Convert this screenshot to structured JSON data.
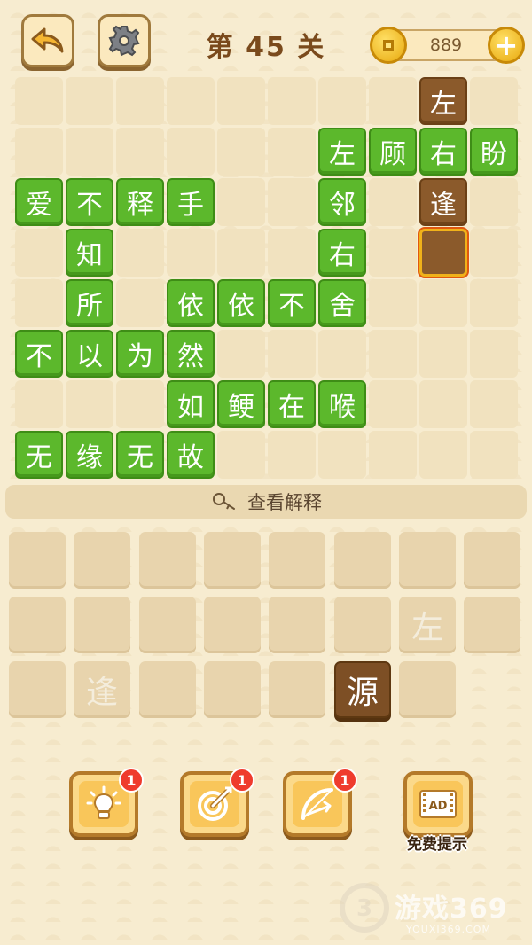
{
  "header": {
    "back_icon": "back-arrow-icon",
    "settings_icon": "gear-icon",
    "level_title": "第 45 关",
    "coins": "889",
    "plus_label": "+"
  },
  "colors": {
    "green_tile": "#5cb82c",
    "brown_tile": "#8b5a2b",
    "empty_cell": "#f1e2bf",
    "selected_border": "#f0b21a"
  },
  "board": {
    "rows": 8,
    "cols": 10,
    "tiles": [
      {
        "row": 0,
        "col": 8,
        "char": "左",
        "style": "brown"
      },
      {
        "row": 1,
        "col": 6,
        "char": "左",
        "style": "green"
      },
      {
        "row": 1,
        "col": 7,
        "char": "顾",
        "style": "green"
      },
      {
        "row": 1,
        "col": 8,
        "char": "右",
        "style": "green"
      },
      {
        "row": 1,
        "col": 9,
        "char": "盼",
        "style": "green"
      },
      {
        "row": 2,
        "col": 0,
        "char": "爱",
        "style": "green"
      },
      {
        "row": 2,
        "col": 1,
        "char": "不",
        "style": "green"
      },
      {
        "row": 2,
        "col": 2,
        "char": "释",
        "style": "green"
      },
      {
        "row": 2,
        "col": 3,
        "char": "手",
        "style": "green"
      },
      {
        "row": 2,
        "col": 6,
        "char": "邻",
        "style": "green"
      },
      {
        "row": 2,
        "col": 8,
        "char": "逢",
        "style": "brown"
      },
      {
        "row": 3,
        "col": 1,
        "char": "知",
        "style": "green"
      },
      {
        "row": 3,
        "col": 6,
        "char": "右",
        "style": "green"
      },
      {
        "row": 3,
        "col": 8,
        "char": "",
        "style": "selected"
      },
      {
        "row": 4,
        "col": 1,
        "char": "所",
        "style": "green"
      },
      {
        "row": 4,
        "col": 3,
        "char": "依",
        "style": "green"
      },
      {
        "row": 4,
        "col": 4,
        "char": "依",
        "style": "green"
      },
      {
        "row": 4,
        "col": 5,
        "char": "不",
        "style": "green"
      },
      {
        "row": 4,
        "col": 6,
        "char": "舍",
        "style": "green"
      },
      {
        "row": 5,
        "col": 0,
        "char": "不",
        "style": "green"
      },
      {
        "row": 5,
        "col": 1,
        "char": "以",
        "style": "green"
      },
      {
        "row": 5,
        "col": 2,
        "char": "为",
        "style": "green"
      },
      {
        "row": 5,
        "col": 3,
        "char": "然",
        "style": "green"
      },
      {
        "row": 6,
        "col": 3,
        "char": "如",
        "style": "green"
      },
      {
        "row": 6,
        "col": 4,
        "char": "鲠",
        "style": "green"
      },
      {
        "row": 6,
        "col": 5,
        "char": "在",
        "style": "green"
      },
      {
        "row": 6,
        "col": 6,
        "char": "喉",
        "style": "green"
      },
      {
        "row": 7,
        "col": 0,
        "char": "无",
        "style": "green"
      },
      {
        "row": 7,
        "col": 1,
        "char": "缘",
        "style": "green"
      },
      {
        "row": 7,
        "col": 2,
        "char": "无",
        "style": "green"
      },
      {
        "row": 7,
        "col": 3,
        "char": "故",
        "style": "green"
      }
    ]
  },
  "explain": {
    "icon": "magnifier-icon",
    "label": "查看解释"
  },
  "tray": {
    "rows": 3,
    "cols": 8,
    "last_row_cols": 7,
    "items": [
      {
        "row": 1,
        "col": 6,
        "char": "左",
        "state": "used"
      },
      {
        "row": 2,
        "col": 1,
        "char": "逢",
        "state": "used"
      },
      {
        "row": 2,
        "col": 5,
        "char": "源",
        "state": "active"
      }
    ]
  },
  "tools": [
    {
      "name": "hint-tool",
      "icon": "lightbulb-icon",
      "badge": "1"
    },
    {
      "name": "target-tool",
      "icon": "target-icon",
      "badge": "1"
    },
    {
      "name": "bow-tool",
      "icon": "bow-arrow-icon",
      "badge": "1"
    },
    {
      "name": "ad-tool",
      "icon": "ad-video-icon",
      "badge": ""
    }
  ],
  "free_hint_label": "免费提示",
  "watermark": {
    "text": "游戏369",
    "url": "YOUXI369.COM"
  }
}
